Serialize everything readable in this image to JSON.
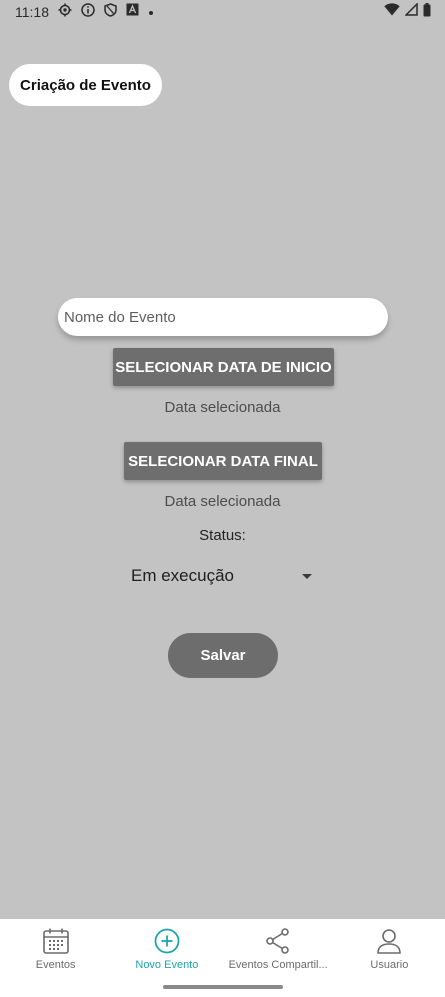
{
  "status_bar": {
    "time": "11:18"
  },
  "header": {
    "title": "Criação de Evento"
  },
  "form": {
    "event_name_placeholder": "Nome do Evento",
    "start_button": "SELECIONAR DATA DE INICIO",
    "start_selected": "Data selecionada",
    "end_button": "SELECIONAR DATA FINAL",
    "end_selected": "Data selecionada",
    "status_label": "Status:",
    "status_value": "Em execução",
    "save_button": "Salvar"
  },
  "bottom_nav": {
    "items": [
      {
        "label": "Eventos",
        "icon": "calendar-icon",
        "active": false
      },
      {
        "label": "Novo Evento",
        "icon": "add-circle-icon",
        "active": true
      },
      {
        "label": "Eventos Compartil...",
        "icon": "share-icon",
        "active": false
      },
      {
        "label": "Usuario",
        "icon": "user-icon",
        "active": false
      }
    ]
  },
  "colors": {
    "accent": "#1ea6ad",
    "background": "#c3c3c3",
    "button": "#6e6e6e"
  }
}
